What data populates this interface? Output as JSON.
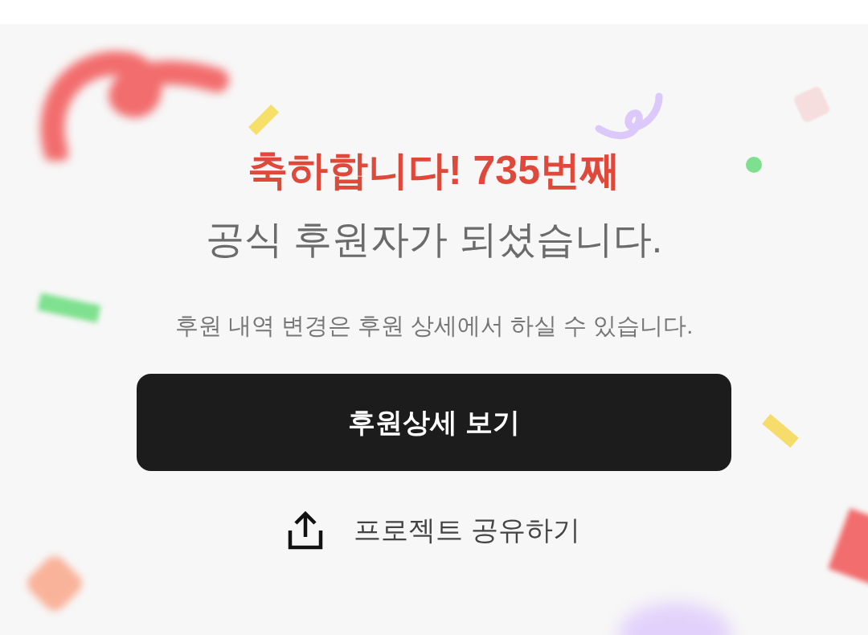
{
  "headline": "축하합니다! 735번째",
  "title": "공식 후원자가 되셨습니다.",
  "subtitle": "후원 내역 변경은 후원 상세에서 하실 수 있습니다.",
  "primary_button": "후원상세 보기",
  "share_link": "프로젝트 공유하기"
}
